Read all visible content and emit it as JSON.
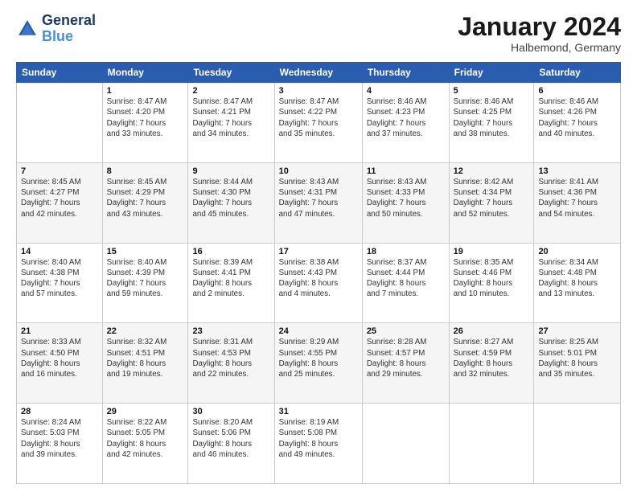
{
  "header": {
    "logo_line1": "General",
    "logo_line2": "Blue",
    "month_title": "January 2024",
    "subtitle": "Halbemond, Germany"
  },
  "weekdays": [
    "Sunday",
    "Monday",
    "Tuesday",
    "Wednesday",
    "Thursday",
    "Friday",
    "Saturday"
  ],
  "weeks": [
    [
      {
        "day": "",
        "sunrise": "",
        "sunset": "",
        "daylight": ""
      },
      {
        "day": "1",
        "sunrise": "Sunrise: 8:47 AM",
        "sunset": "Sunset: 4:20 PM",
        "daylight": "Daylight: 7 hours and 33 minutes."
      },
      {
        "day": "2",
        "sunrise": "Sunrise: 8:47 AM",
        "sunset": "Sunset: 4:21 PM",
        "daylight": "Daylight: 7 hours and 34 minutes."
      },
      {
        "day": "3",
        "sunrise": "Sunrise: 8:47 AM",
        "sunset": "Sunset: 4:22 PM",
        "daylight": "Daylight: 7 hours and 35 minutes."
      },
      {
        "day": "4",
        "sunrise": "Sunrise: 8:46 AM",
        "sunset": "Sunset: 4:23 PM",
        "daylight": "Daylight: 7 hours and 37 minutes."
      },
      {
        "day": "5",
        "sunrise": "Sunrise: 8:46 AM",
        "sunset": "Sunset: 4:25 PM",
        "daylight": "Daylight: 7 hours and 38 minutes."
      },
      {
        "day": "6",
        "sunrise": "Sunrise: 8:46 AM",
        "sunset": "Sunset: 4:26 PM",
        "daylight": "Daylight: 7 hours and 40 minutes."
      }
    ],
    [
      {
        "day": "7",
        "sunrise": "Sunrise: 8:45 AM",
        "sunset": "Sunset: 4:27 PM",
        "daylight": "Daylight: 7 hours and 42 minutes."
      },
      {
        "day": "8",
        "sunrise": "Sunrise: 8:45 AM",
        "sunset": "Sunset: 4:29 PM",
        "daylight": "Daylight: 7 hours and 43 minutes."
      },
      {
        "day": "9",
        "sunrise": "Sunrise: 8:44 AM",
        "sunset": "Sunset: 4:30 PM",
        "daylight": "Daylight: 7 hours and 45 minutes."
      },
      {
        "day": "10",
        "sunrise": "Sunrise: 8:43 AM",
        "sunset": "Sunset: 4:31 PM",
        "daylight": "Daylight: 7 hours and 47 minutes."
      },
      {
        "day": "11",
        "sunrise": "Sunrise: 8:43 AM",
        "sunset": "Sunset: 4:33 PM",
        "daylight": "Daylight: 7 hours and 50 minutes."
      },
      {
        "day": "12",
        "sunrise": "Sunrise: 8:42 AM",
        "sunset": "Sunset: 4:34 PM",
        "daylight": "Daylight: 7 hours and 52 minutes."
      },
      {
        "day": "13",
        "sunrise": "Sunrise: 8:41 AM",
        "sunset": "Sunset: 4:36 PM",
        "daylight": "Daylight: 7 hours and 54 minutes."
      }
    ],
    [
      {
        "day": "14",
        "sunrise": "Sunrise: 8:40 AM",
        "sunset": "Sunset: 4:38 PM",
        "daylight": "Daylight: 7 hours and 57 minutes."
      },
      {
        "day": "15",
        "sunrise": "Sunrise: 8:40 AM",
        "sunset": "Sunset: 4:39 PM",
        "daylight": "Daylight: 7 hours and 59 minutes."
      },
      {
        "day": "16",
        "sunrise": "Sunrise: 8:39 AM",
        "sunset": "Sunset: 4:41 PM",
        "daylight": "Daylight: 8 hours and 2 minutes."
      },
      {
        "day": "17",
        "sunrise": "Sunrise: 8:38 AM",
        "sunset": "Sunset: 4:43 PM",
        "daylight": "Daylight: 8 hours and 4 minutes."
      },
      {
        "day": "18",
        "sunrise": "Sunrise: 8:37 AM",
        "sunset": "Sunset: 4:44 PM",
        "daylight": "Daylight: 8 hours and 7 minutes."
      },
      {
        "day": "19",
        "sunrise": "Sunrise: 8:35 AM",
        "sunset": "Sunset: 4:46 PM",
        "daylight": "Daylight: 8 hours and 10 minutes."
      },
      {
        "day": "20",
        "sunrise": "Sunrise: 8:34 AM",
        "sunset": "Sunset: 4:48 PM",
        "daylight": "Daylight: 8 hours and 13 minutes."
      }
    ],
    [
      {
        "day": "21",
        "sunrise": "Sunrise: 8:33 AM",
        "sunset": "Sunset: 4:50 PM",
        "daylight": "Daylight: 8 hours and 16 minutes."
      },
      {
        "day": "22",
        "sunrise": "Sunrise: 8:32 AM",
        "sunset": "Sunset: 4:51 PM",
        "daylight": "Daylight: 8 hours and 19 minutes."
      },
      {
        "day": "23",
        "sunrise": "Sunrise: 8:31 AM",
        "sunset": "Sunset: 4:53 PM",
        "daylight": "Daylight: 8 hours and 22 minutes."
      },
      {
        "day": "24",
        "sunrise": "Sunrise: 8:29 AM",
        "sunset": "Sunset: 4:55 PM",
        "daylight": "Daylight: 8 hours and 25 minutes."
      },
      {
        "day": "25",
        "sunrise": "Sunrise: 8:28 AM",
        "sunset": "Sunset: 4:57 PM",
        "daylight": "Daylight: 8 hours and 29 minutes."
      },
      {
        "day": "26",
        "sunrise": "Sunrise: 8:27 AM",
        "sunset": "Sunset: 4:59 PM",
        "daylight": "Daylight: 8 hours and 32 minutes."
      },
      {
        "day": "27",
        "sunrise": "Sunrise: 8:25 AM",
        "sunset": "Sunset: 5:01 PM",
        "daylight": "Daylight: 8 hours and 35 minutes."
      }
    ],
    [
      {
        "day": "28",
        "sunrise": "Sunrise: 8:24 AM",
        "sunset": "Sunset: 5:03 PM",
        "daylight": "Daylight: 8 hours and 39 minutes."
      },
      {
        "day": "29",
        "sunrise": "Sunrise: 8:22 AM",
        "sunset": "Sunset: 5:05 PM",
        "daylight": "Daylight: 8 hours and 42 minutes."
      },
      {
        "day": "30",
        "sunrise": "Sunrise: 8:20 AM",
        "sunset": "Sunset: 5:06 PM",
        "daylight": "Daylight: 8 hours and 46 minutes."
      },
      {
        "day": "31",
        "sunrise": "Sunrise: 8:19 AM",
        "sunset": "Sunset: 5:08 PM",
        "daylight": "Daylight: 8 hours and 49 minutes."
      },
      {
        "day": "",
        "sunrise": "",
        "sunset": "",
        "daylight": ""
      },
      {
        "day": "",
        "sunrise": "",
        "sunset": "",
        "daylight": ""
      },
      {
        "day": "",
        "sunrise": "",
        "sunset": "",
        "daylight": ""
      }
    ]
  ]
}
